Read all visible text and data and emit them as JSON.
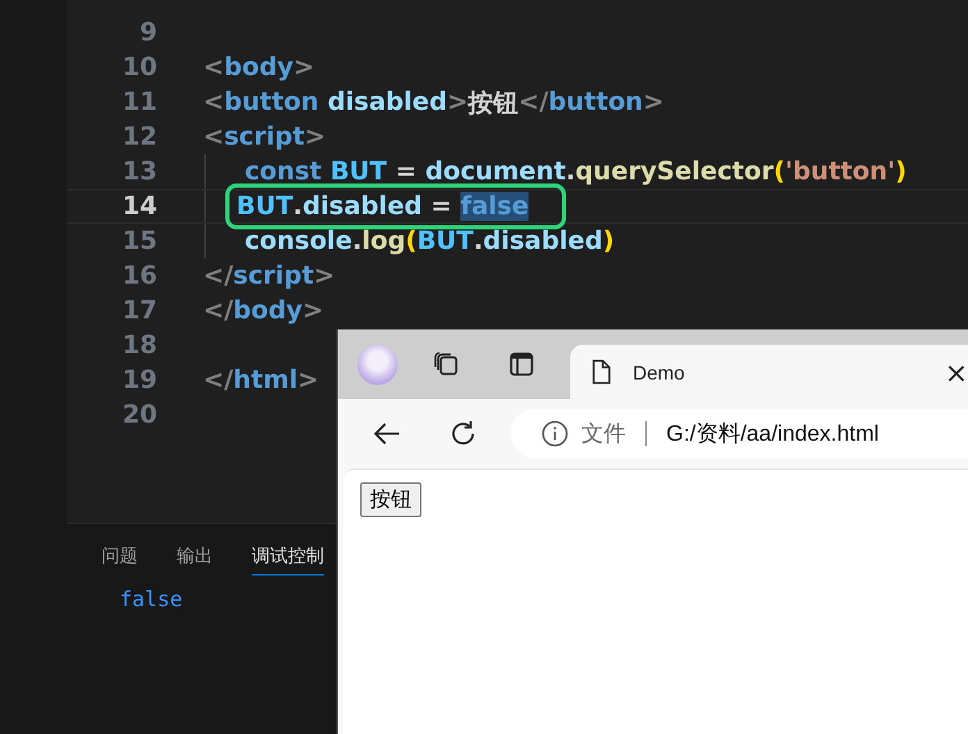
{
  "editor": {
    "lines": [
      {
        "number": "9",
        "current": false
      },
      {
        "number": "10",
        "current": false,
        "tokens": [
          {
            "text": "<",
            "kind": "punct"
          },
          {
            "text": "body",
            "kind": "tag"
          },
          {
            "text": ">",
            "kind": "punct"
          }
        ]
      },
      {
        "number": "11",
        "current": false,
        "tokens": [
          {
            "text": "<",
            "kind": "punct"
          },
          {
            "text": "button",
            "kind": "tag"
          },
          {
            "text": " disabled",
            "kind": "attr"
          },
          {
            "text": ">",
            "kind": "punct"
          },
          {
            "text": "按钮",
            "kind": "text"
          },
          {
            "text": "</",
            "kind": "punct"
          },
          {
            "text": "button",
            "kind": "tag"
          },
          {
            "text": ">",
            "kind": "punct"
          }
        ]
      },
      {
        "number": "12",
        "current": false,
        "tokens": [
          {
            "text": "<",
            "kind": "punct"
          },
          {
            "text": "script",
            "kind": "tag"
          },
          {
            "text": ">",
            "kind": "punct"
          }
        ],
        "children": [
          {
            "number": "13",
            "current": false,
            "tokens": [
              {
                "text": "const",
                "kind": "keyword"
              },
              {
                "text": " BUT",
                "kind": "const"
              },
              {
                "text": " = ",
                "kind": "plain"
              },
              {
                "text": "document",
                "kind": "var"
              },
              {
                "text": ".",
                "kind": "plain"
              },
              {
                "text": "querySelector",
                "kind": "func"
              },
              {
                "text": "(",
                "kind": "paren"
              },
              {
                "text": "'button'",
                "kind": "string"
              },
              {
                "text": ")",
                "kind": "paren"
              }
            ]
          },
          {
            "number": "14",
            "current": true,
            "tokens": [
              {
                "text": "BUT",
                "kind": "const"
              },
              {
                "text": ".",
                "kind": "plain"
              },
              {
                "text": "disabled",
                "kind": "var"
              },
              {
                "text": " = ",
                "kind": "plain"
              },
              {
                "text": "false",
                "kind": "selection"
              }
            ]
          },
          {
            "number": "15",
            "current": false,
            "tokens": [
              {
                "text": "console",
                "kind": "var"
              },
              {
                "text": ".",
                "kind": "plain"
              },
              {
                "text": "log",
                "kind": "func"
              },
              {
                "text": "(",
                "kind": "paren"
              },
              {
                "text": "BUT",
                "kind": "const"
              },
              {
                "text": ".",
                "kind": "plain"
              },
              {
                "text": "disabled",
                "kind": "var"
              },
              {
                "text": ")",
                "kind": "paren"
              }
            ]
          }
        ]
      },
      {
        "number": "16",
        "current": false,
        "tokens": [
          {
            "text": "</",
            "kind": "punct"
          },
          {
            "text": "script",
            "kind": "tag"
          },
          {
            "text": ">",
            "kind": "punct"
          }
        ]
      },
      {
        "number": "17",
        "current": false,
        "tokens": [
          {
            "text": "</",
            "kind": "punct"
          },
          {
            "text": "body",
            "kind": "tag"
          },
          {
            "text": ">",
            "kind": "punct"
          }
        ]
      },
      {
        "number": "18",
        "current": false
      },
      {
        "number": "19",
        "current": false,
        "tokens": [
          {
            "text": "</",
            "kind": "punct"
          },
          {
            "text": "html",
            "kind": "tag"
          },
          {
            "text": ">",
            "kind": "punct"
          }
        ]
      },
      {
        "number": "20",
        "current": false
      }
    ]
  },
  "panel": {
    "tabs": [
      {
        "label": "问题",
        "selected": false
      },
      {
        "label": "输出",
        "selected": false
      },
      {
        "label": "调试控制",
        "selected": true
      }
    ],
    "output": [
      "false"
    ]
  },
  "browser": {
    "tab": {
      "title": "Demo",
      "close": "×"
    },
    "address": {
      "label": "文件",
      "url": "G:/资料/aa/index.html"
    },
    "page": {
      "button": {
        "label": "按钮",
        "disabled": false
      }
    }
  }
}
